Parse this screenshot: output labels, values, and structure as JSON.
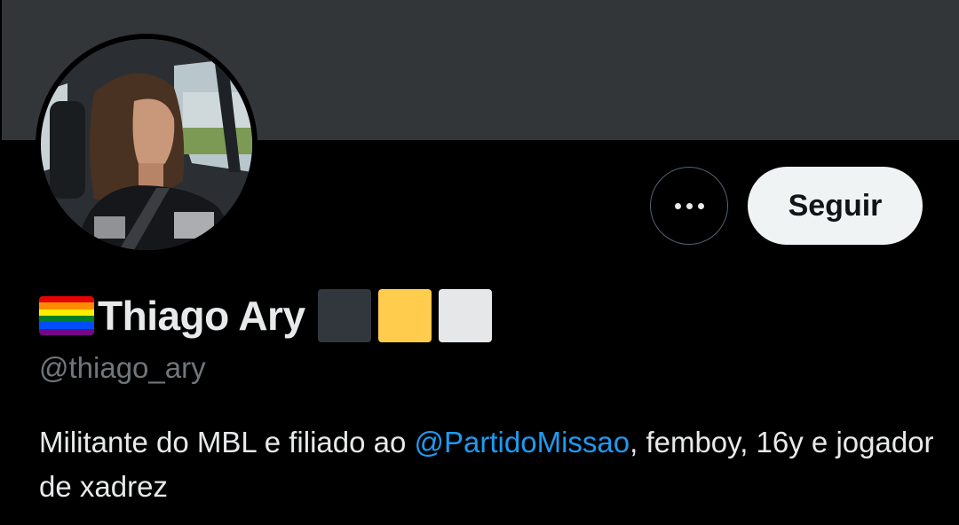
{
  "profile": {
    "name": "Thiago Ary",
    "handle": "@thiago_ary",
    "bio": {
      "before": "Militante do MBL e filiado ao ",
      "mention": "@PartidoMissao",
      "after": ", femboy, 16y e jogador de xadrez"
    }
  },
  "actions": {
    "more_icon": "more-horizontal-icon",
    "follow_label": "Seguir"
  },
  "name_decorations": {
    "flag": "rainbow-flag-icon",
    "flag_colors": [
      "#e40303",
      "#ff8c00",
      "#ffed00",
      "#008026",
      "#004dff",
      "#750787"
    ],
    "squares": [
      {
        "icon": "black-square-icon",
        "color": "#31373d"
      },
      {
        "icon": "yellow-square-icon",
        "color": "#ffcc4d"
      },
      {
        "icon": "white-square-icon",
        "color": "#e6e7e8"
      }
    ]
  },
  "theme": {
    "background": "#000000",
    "banner": "#333639",
    "text_primary": "#e7e9ea",
    "text_secondary": "#71767b",
    "link": "#1d9bf0",
    "follow_bg": "#eff3f4",
    "follow_text": "#0f1419"
  }
}
